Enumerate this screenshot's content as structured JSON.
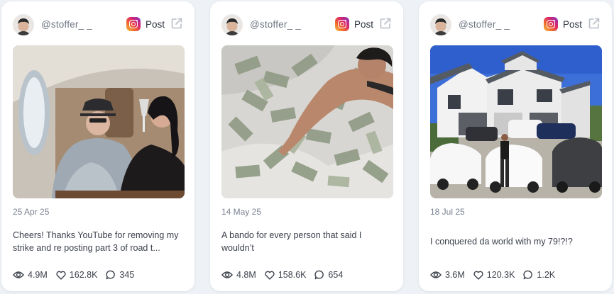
{
  "posts": [
    {
      "username": "@stoffer_ _",
      "platform_label": "Post",
      "date": "25 Apr 25",
      "caption": "Cheers! Thanks YouTube for removing my strike and re posting part 3 of road t...",
      "views": "4.9M",
      "likes": "162.8K",
      "comments": "345"
    },
    {
      "username": "@stoffer_ _",
      "platform_label": "Post",
      "date": "14 May 25",
      "caption": "A bando for every person that said I wouldn’t",
      "views": "4.8M",
      "likes": "158.6K",
      "comments": "654"
    },
    {
      "username": "@stoffer_ _",
      "platform_label": "Post",
      "date": "18 Jul 25",
      "caption": "I conquered da world with my 79!?!?",
      "views": "3.6M",
      "likes": "120.3K",
      "comments": "1.2K"
    }
  ],
  "icons": {
    "platform": "instagram-icon",
    "open": "external-link-icon",
    "views": "eye-icon",
    "likes": "heart-icon",
    "comments": "comment-icon"
  },
  "colors": {
    "background": "#eef1f5",
    "card": "#ffffff",
    "muted_text": "#7a8190",
    "body_text": "#3a3f4a"
  }
}
